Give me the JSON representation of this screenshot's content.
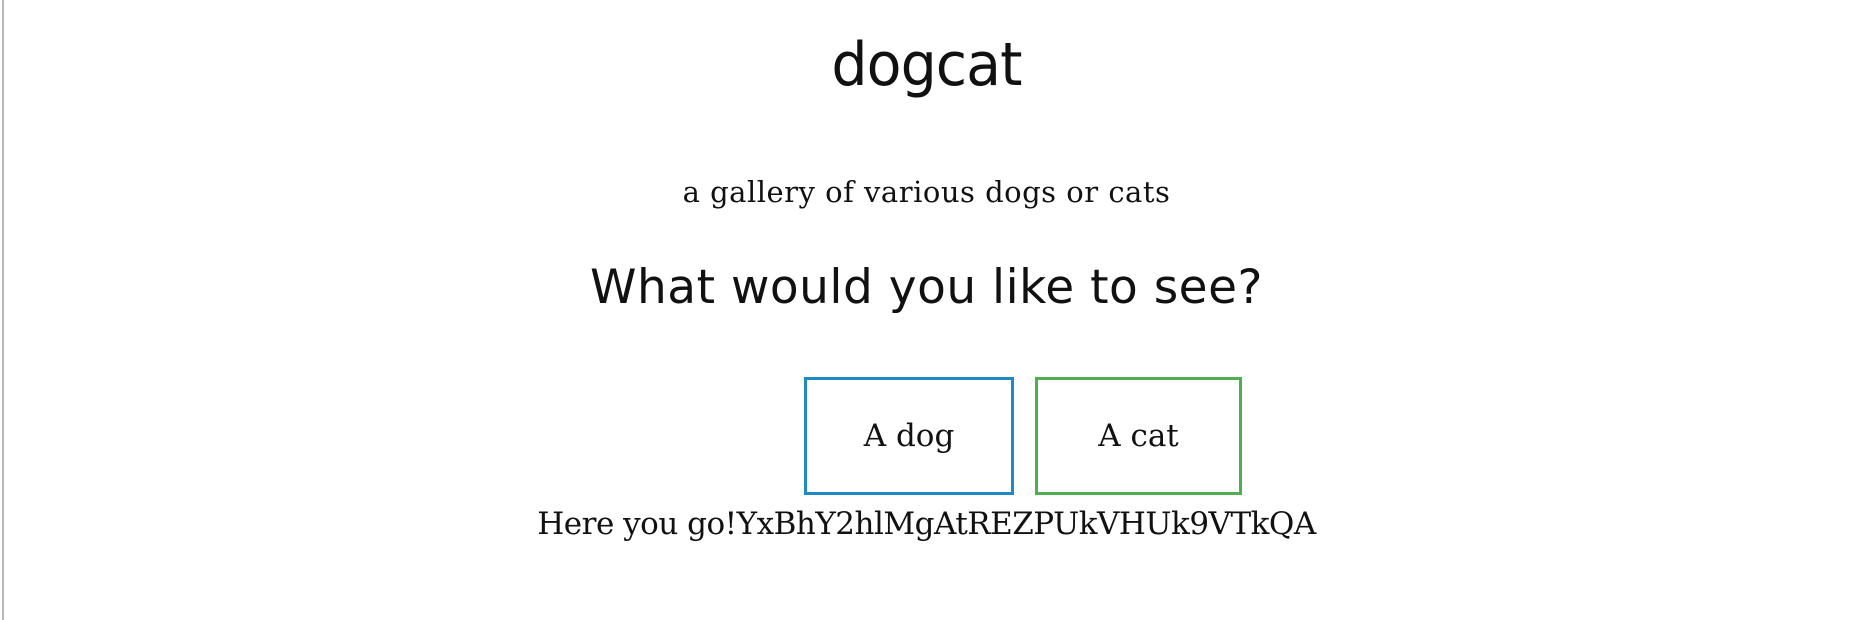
{
  "header": {
    "title": "dogcat",
    "tagline": "a gallery of various dogs or cats"
  },
  "main": {
    "question": "What would you like to see?",
    "buttons": {
      "dog": {
        "label": "A dog",
        "border_color": "#1f8bc6"
      },
      "cat": {
        "label": "A cat",
        "border_color": "#4caf50"
      }
    },
    "result_text": "Here you go!YxBhY2hlMgAtREZPUkVHUk9VTkQA"
  },
  "colors": {
    "background": "#ffffff",
    "text": "#111111",
    "left_border": "#b8b8b8"
  }
}
